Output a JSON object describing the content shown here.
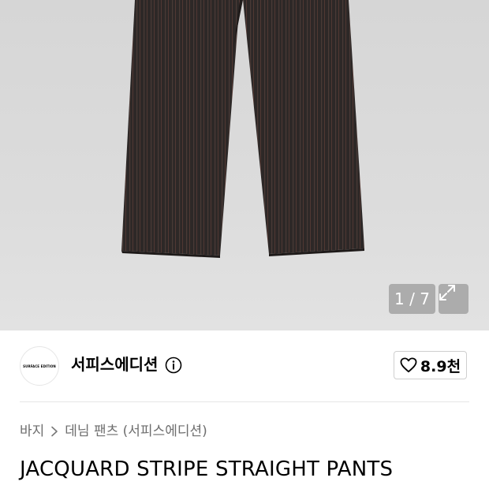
{
  "gallery": {
    "counter": "1 / 7",
    "expand_icon": "expand-arrows-icon"
  },
  "brand": {
    "logo_text": "SURFACE EDITION",
    "name": "서피스에디션",
    "info_icon": "info-icon"
  },
  "like": {
    "icon": "heart-outline-icon",
    "count": "8.9천"
  },
  "breadcrumb": {
    "items": [
      "바지",
      "데님 팬츠 (서피스에디션)"
    ],
    "separator_icon": "chevron-right-icon"
  },
  "product": {
    "title": "JACQUARD STRIPE STRAIGHT PANTS"
  }
}
